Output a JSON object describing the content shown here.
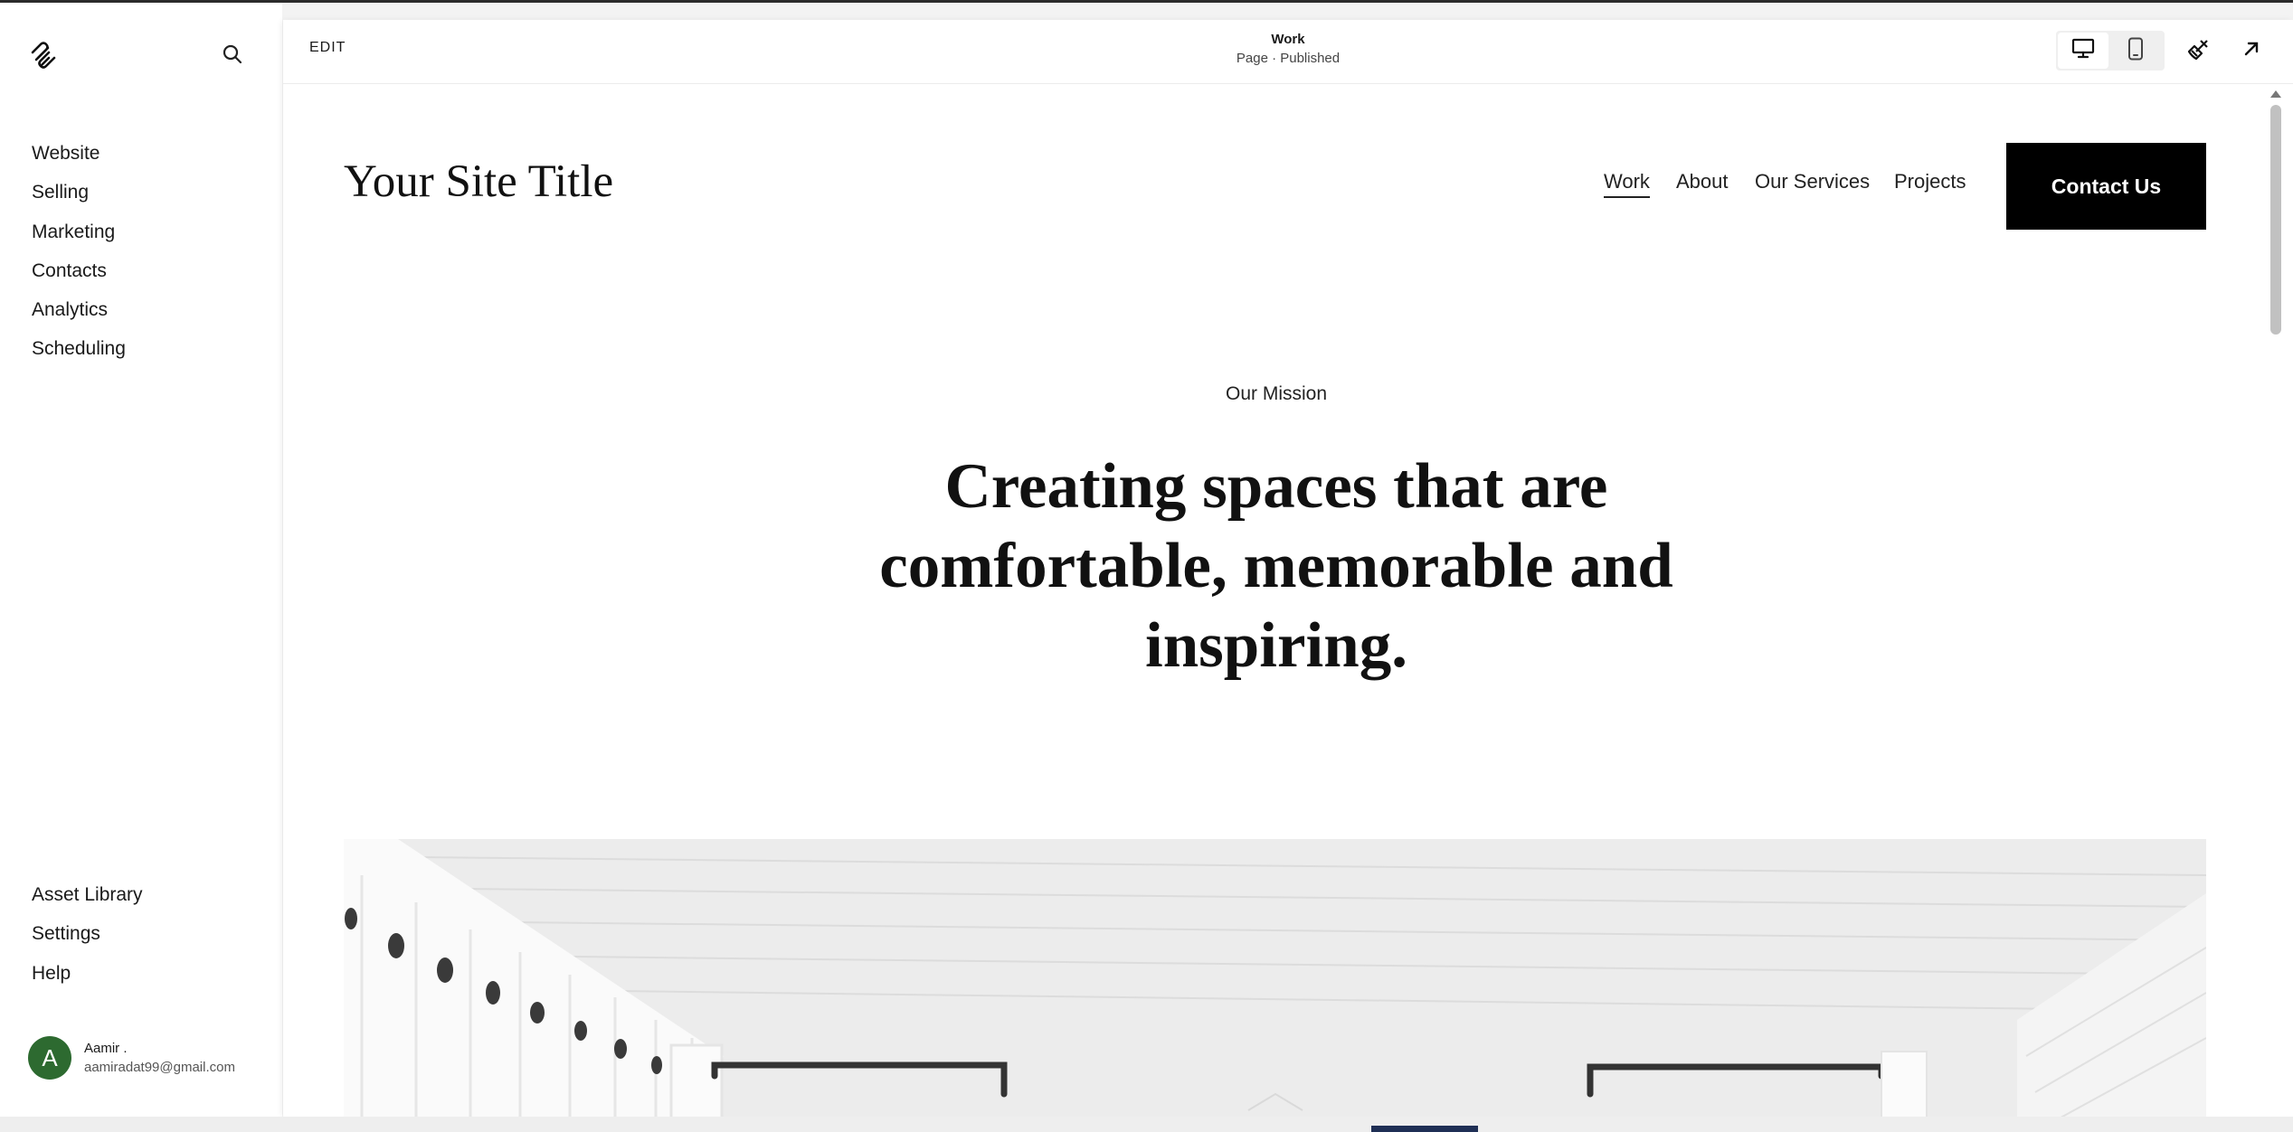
{
  "sidebar": {
    "nav": [
      {
        "label": "Website"
      },
      {
        "label": "Selling"
      },
      {
        "label": "Marketing"
      },
      {
        "label": "Contacts"
      },
      {
        "label": "Analytics"
      },
      {
        "label": "Scheduling"
      }
    ],
    "bottom_nav": [
      {
        "label": "Asset Library"
      },
      {
        "label": "Settings"
      },
      {
        "label": "Help"
      }
    ],
    "user": {
      "initial": "A",
      "name": "Aamir .",
      "email": "aamiradat99@gmail.com",
      "avatar_color": "#2d6a30"
    }
  },
  "editor": {
    "edit_label": "EDIT",
    "page_title": "Work",
    "page_status": "Page · Published"
  },
  "site": {
    "title": "Your Site Title",
    "nav": [
      {
        "label": "Work",
        "active": true
      },
      {
        "label": "About"
      },
      {
        "label": "Our Services"
      },
      {
        "label": "Projects"
      }
    ],
    "cta_label": "Contact Us",
    "mission_label": "Our Mission",
    "headline_lines": [
      "Creating spaces that are",
      "comfortable, memorable and",
      "inspiring."
    ]
  },
  "icons": {
    "logo": "squarespace-logo-icon",
    "search": "search-icon",
    "desktop": "desktop-icon",
    "mobile": "mobile-icon",
    "design": "paintbrush-icon",
    "exit": "arrow-up-right-icon"
  },
  "colors": {
    "accent_dark": "#000000",
    "bottom_tab": "#1f2f55"
  }
}
